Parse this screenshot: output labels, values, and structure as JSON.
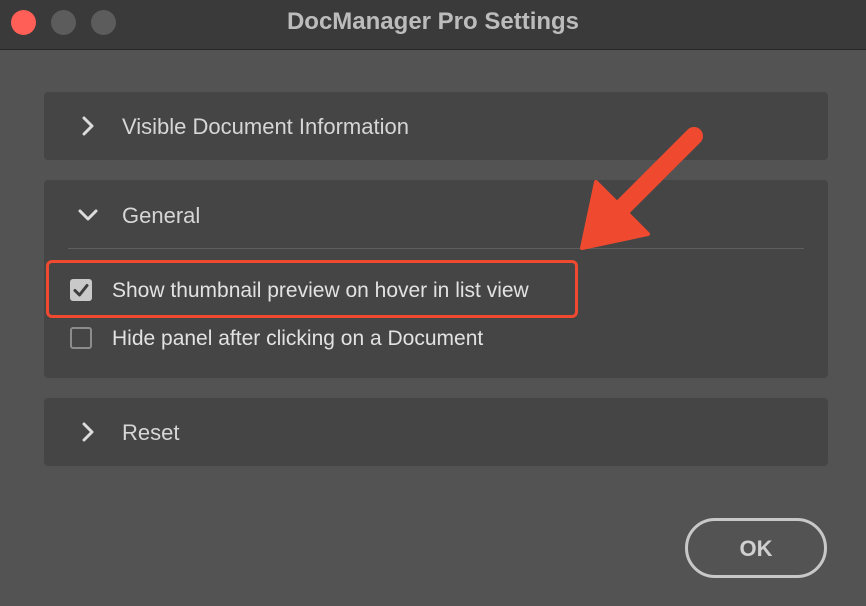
{
  "window": {
    "title": "DocManager Pro Settings",
    "buttons": {
      "close": {
        "color": "#ff5f57"
      },
      "minimize": {
        "color": "#5c5c5c"
      },
      "zoom": {
        "color": "#5c5c5c"
      }
    }
  },
  "sections": [
    {
      "title": "Visible Document Information",
      "expanded": false,
      "icon": "chevron-right-icon"
    },
    {
      "title": "General",
      "expanded": true,
      "icon": "chevron-down-icon",
      "options": [
        {
          "label": "Show thumbnail preview on hover in list view",
          "checked": true
        },
        {
          "label": "Hide panel after clicking on a Document",
          "checked": false
        }
      ]
    },
    {
      "title": "Reset",
      "expanded": false,
      "icon": "chevron-right-icon"
    }
  ],
  "footer": {
    "ok_label": "OK"
  },
  "annotation": {
    "color": "#ef4a2f",
    "target": "Show thumbnail preview on hover in list view"
  }
}
